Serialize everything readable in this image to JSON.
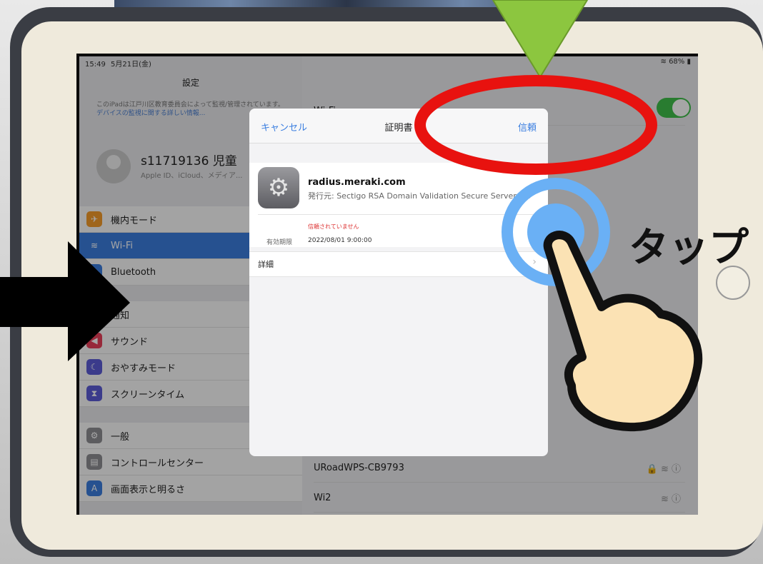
{
  "status_bar": {
    "time": "15:49",
    "date": "5月21日(金)",
    "battery": "68%"
  },
  "sidebar": {
    "title": "設定",
    "managed_notice_part1": "このiPadは江戸川区教育委員会によって監視/管理されています。",
    "managed_notice_link": "デバイスの監視に関する詳しい情報...",
    "profile": {
      "name": "s11719136 児童",
      "subtitle": "Apple ID、iCloud、メディア..."
    },
    "items": [
      {
        "label": "機内モード",
        "icon": "airplane-icon",
        "color": "#f49b2a"
      },
      {
        "label": "Wi-Fi",
        "icon": "wifi-icon",
        "color": "#3b7ddd",
        "active": true
      },
      {
        "label": "Bluetooth",
        "icon": "bluetooth-icon",
        "color": "#3b7ddd"
      },
      {
        "label": "通知",
        "icon": "notifications-icon",
        "color": "#e8403d"
      },
      {
        "label": "サウンド",
        "icon": "sound-icon",
        "color": "#e8405a"
      },
      {
        "label": "おやすみモード",
        "icon": "moon-icon",
        "color": "#5b5bd6"
      },
      {
        "label": "スクリーンタイム",
        "icon": "hourglass-icon",
        "color": "#5b5bd6"
      },
      {
        "label": "一般",
        "icon": "gear-icon",
        "color": "#8e8e93"
      },
      {
        "label": "コントロールセンター",
        "icon": "control-center-icon",
        "color": "#8e8e93"
      },
      {
        "label": "画面表示と明るさ",
        "icon": "display-icon",
        "color": "#3b7ddd"
      }
    ]
  },
  "wifi": {
    "header": "Wi-Fi",
    "networks": [
      {
        "name": "URoadWPS-CB9793"
      },
      {
        "name": "Wi2"
      }
    ]
  },
  "certificate_dialog": {
    "cancel_label": "キャンセル",
    "title": "証明書",
    "trust_label": "信頼",
    "domain": "radius.meraki.com",
    "issuer": "発行元: Sectigo RSA Domain Validation Secure Server CA",
    "untrusted_text": "信頼されていません",
    "expiry_label": "有効期限",
    "expiry_value": "2022/08/01 9:00:00",
    "details_label": "詳細"
  },
  "annotation": {
    "tap_text": "タップ",
    "highlight_color": "#e8120f",
    "arrow_down_color": "#8cc63f",
    "ripple_color": "#6ab0f5",
    "hand_color": "#fbe2b4"
  }
}
